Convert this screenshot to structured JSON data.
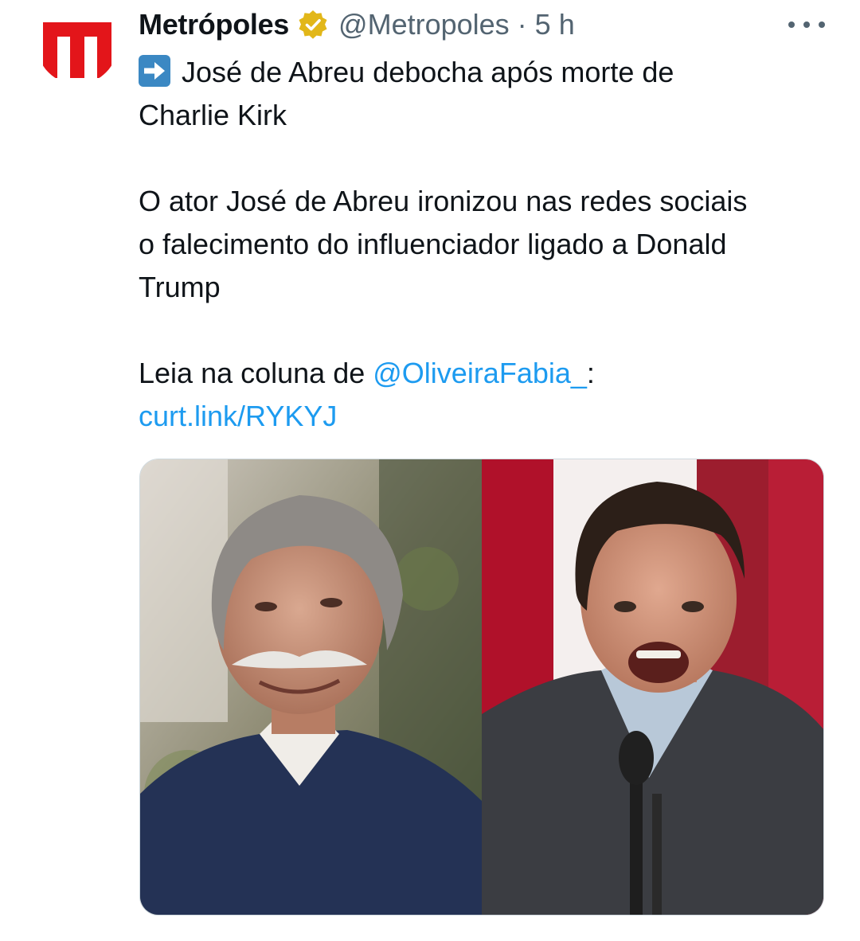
{
  "tweet": {
    "author": {
      "display_name": "Metrópoles",
      "handle": "@Metropoles",
      "separator": "·",
      "time": "5 h",
      "verified": true,
      "avatar_icon": "metropoles-logo-icon",
      "avatar_letter": "m"
    },
    "more_icon": "more-horizontal-icon",
    "text": {
      "headline_emoji": "right-arrow-emoji-icon",
      "line1": "José de Abreu debocha após morte de",
      "line2": "Charlie Kirk",
      "line3": "O ator José de Abreu ironizou nas redes sociais",
      "line4": "o falecimento do influenciador ligado a Donald",
      "line5": "Trump",
      "line6_prefix": "Leia na coluna de ",
      "mention": "@OliveiraFabia_",
      "line6_suffix": ":",
      "url": "curt.link/RYKYJ"
    },
    "media": {
      "left_photo": "photo-jose-de-abreu",
      "right_photo": "photo-charlie-kirk"
    }
  },
  "colors": {
    "text": "#0f1419",
    "secondary": "#536471",
    "link": "#1d9bf0",
    "brand_red": "#e3151a",
    "verified_gold": "#e2b719",
    "emoji_blue": "#3b88c3"
  }
}
